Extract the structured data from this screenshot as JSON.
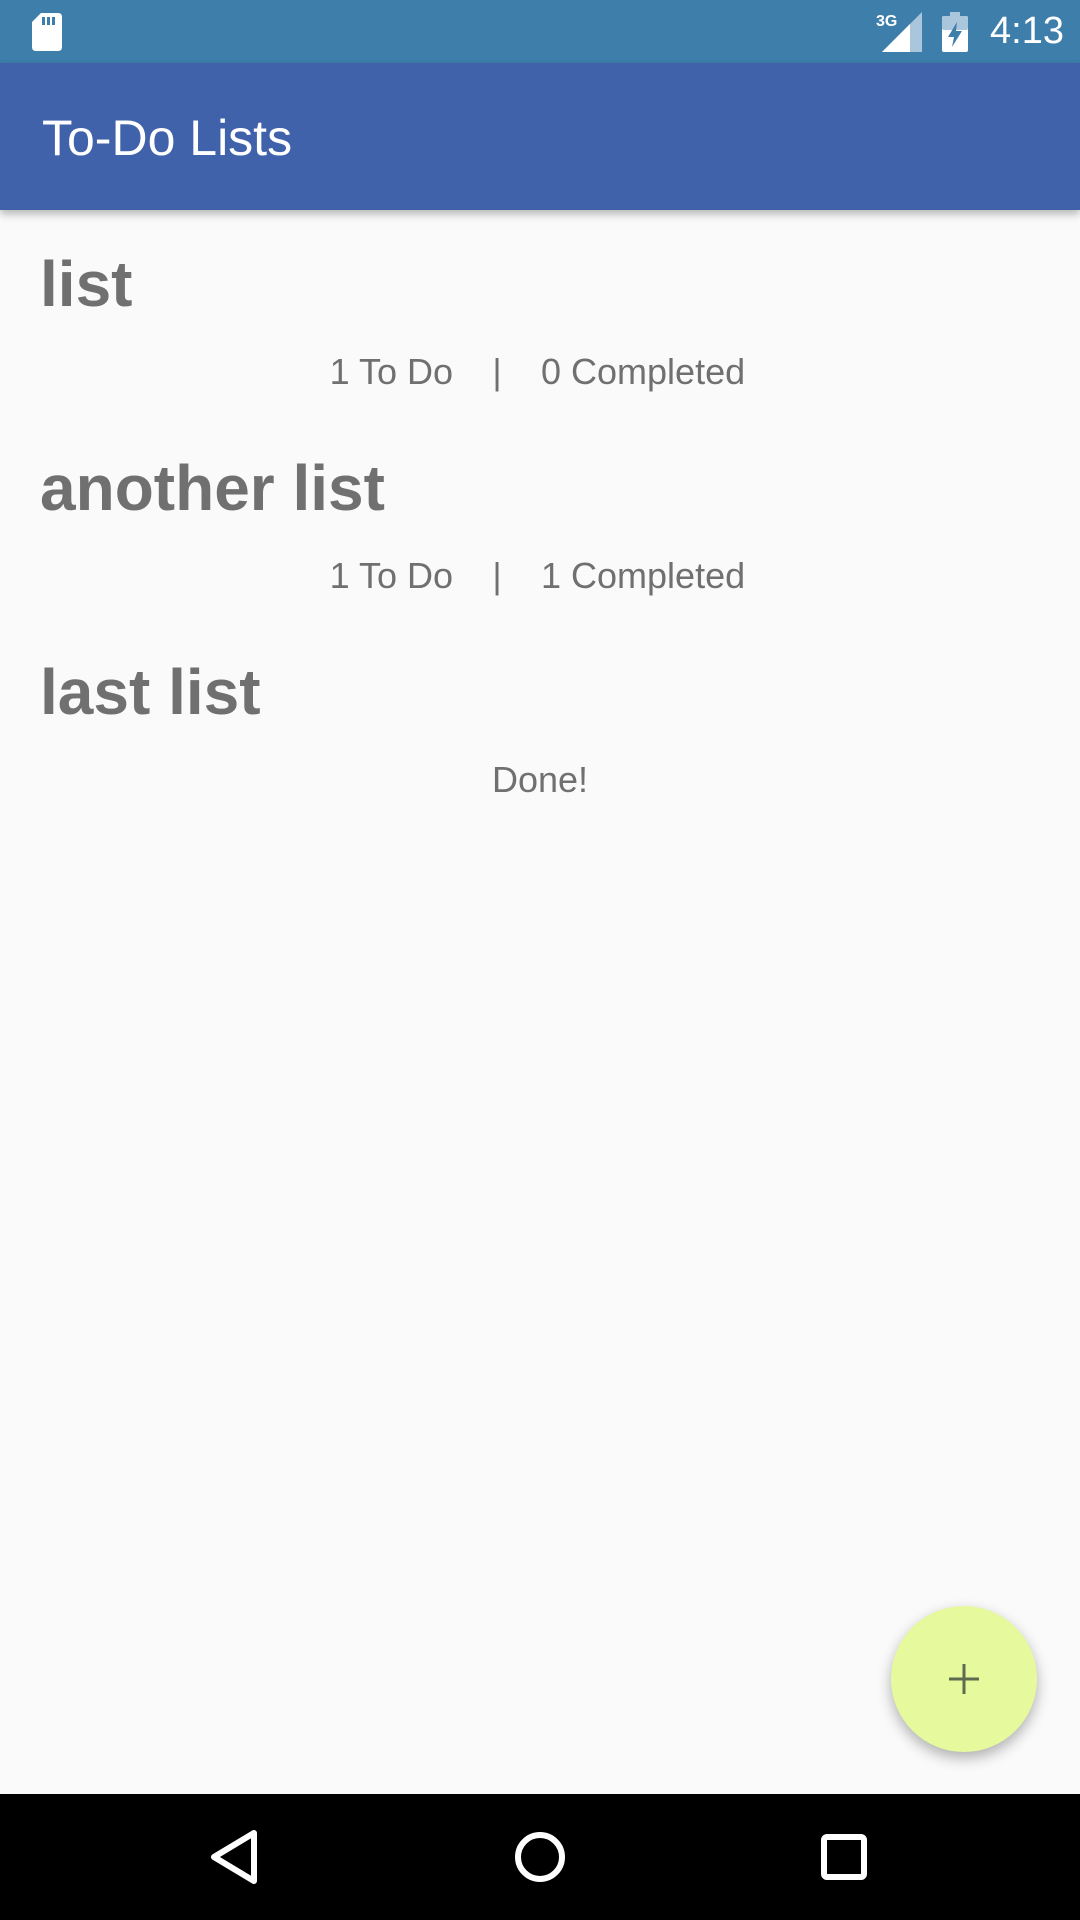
{
  "status_bar": {
    "time": "4:13",
    "network_label": "3G",
    "icons": [
      "sd-card-icon",
      "signal-icon",
      "battery-charging-icon"
    ]
  },
  "app_bar": {
    "title": "To-Do Lists"
  },
  "lists": [
    {
      "name": "list",
      "todo": "1 To Do",
      "separator": "|",
      "completed": "0 Completed"
    },
    {
      "name": "another list",
      "todo": "1 To Do",
      "separator": "|",
      "completed": "1 Completed"
    },
    {
      "name": "last list",
      "done": "Done!"
    }
  ],
  "fab": {
    "icon": "plus-icon",
    "color": "#e6f99d"
  },
  "nav_bar": {
    "icons": [
      "back-icon",
      "home-icon",
      "recents-icon"
    ]
  },
  "colors": {
    "status_bar": "#3e7eab",
    "app_bar": "#4062aa",
    "background": "#fafafa",
    "text_muted": "#707070"
  }
}
